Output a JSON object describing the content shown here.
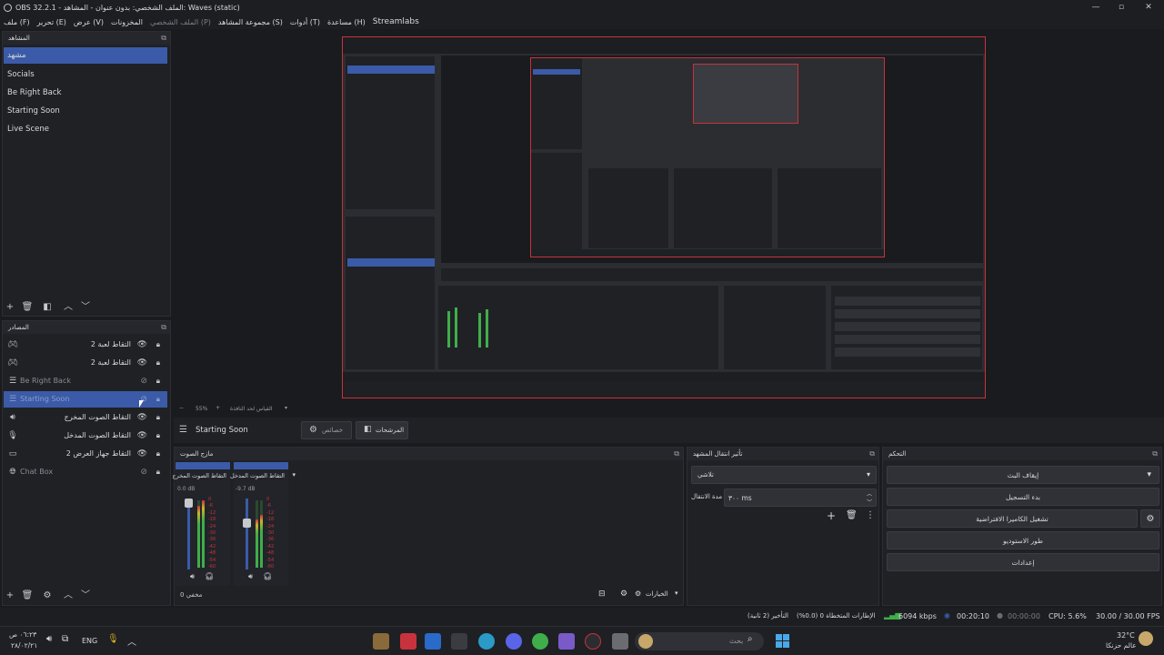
{
  "window": {
    "title": "OBS 32.2.1 - الملف الشخصي: بدون عنوان - المشاهد: Waves (static)",
    "minimize_icon": "—",
    "maximize_icon": "▫",
    "close_icon": "✕"
  },
  "menu": {
    "items": [
      "ملف (F)",
      "تحرير (E)",
      "عرض (V)",
      "المخزونات",
      "الملف الشخصي (P)",
      "مجموعة المشاهد (S)",
      "أدوات (T)",
      "مساعدة (H)",
      "Streamlabs"
    ]
  },
  "scenes": {
    "title": "المشاهد",
    "items": [
      "مشهد",
      "Socials",
      "Be Right Back",
      "Starting Soon",
      "Live Scene"
    ],
    "selected_index": 0
  },
  "sources": {
    "title": "المصادر",
    "items": [
      {
        "name": "التقاط لعبة 2",
        "icon": "gamepad-icon"
      },
      {
        "name": "التقاط لعبة 2",
        "icon": "gamepad-icon"
      },
      {
        "name": "Be Right Back",
        "icon": "list-icon"
      },
      {
        "name": "Starting Soon",
        "icon": "list-icon"
      },
      {
        "name": "التقاط الصوت المخرج",
        "icon": "speaker-icon"
      },
      {
        "name": "التقاط الصوت المدخل",
        "icon": "mic-icon"
      },
      {
        "name": "التقاط جهاز العرض 2",
        "icon": "monitor-icon"
      },
      {
        "name": "Chat Box",
        "icon": "globe-icon"
      }
    ],
    "selected_index": 3
  },
  "preview_bar": {
    "zoom": "55%",
    "fit_label": "القياس لحد النافذة"
  },
  "context_bar": {
    "source_name": "Starting Soon",
    "properties_label": "خصائص",
    "filters_label": "المرشحات"
  },
  "audio_mixer": {
    "title": "مازج الصوت",
    "channels": [
      {
        "name": "التقاط الصوت المخرج",
        "db": "0.0 dB",
        "level": 1.0
      },
      {
        "name": "التقاط الصوت المدخل",
        "db": "-9.7 dB",
        "level": 0.78
      }
    ],
    "scale": [
      "0",
      "-6",
      "-12",
      "-18",
      "-24",
      "-30",
      "-36",
      "-42",
      "-48",
      "-54",
      "-60"
    ],
    "hidden_label": "مخفي 0",
    "options_label": "الخيارات"
  },
  "transitions": {
    "title": "تأثير انتقال المشهد",
    "selected": "تلاشي",
    "duration_label": "مدة الانتقال",
    "duration_value": "٣٠٠ ms"
  },
  "controls": {
    "title": "التحكم",
    "buttons": [
      "إيقاف البث",
      "بدء التسجيل",
      "تشغيل الكاميرا الافتراضية",
      "طور الاستوديو",
      "إعدادات"
    ]
  },
  "status": {
    "frames": "الإطارات المتخطاة 0 (0.0%)",
    "delay": "التأخير (2 ثانية)",
    "bitrate": "6094 kbps",
    "stream_time": "00:20:10",
    "record_time": "00:00:00",
    "cpu": "CPU: 5.6%",
    "fps": "30.00 / 30.00 FPS"
  },
  "taskbar": {
    "time": "٠٦:٢٣ ص",
    "date": "٢٨/٠٢/٢١",
    "lang": "ENG",
    "search_placeholder": "بحث",
    "weather_temp": "32°C",
    "weather_desc": "عالم حزنكا"
  },
  "colors": {
    "accent": "#3b5ba8",
    "canvas_border": "#c8323c",
    "meter_green": "#3fae4a",
    "meter_yellow": "#c9b52a",
    "meter_red": "#c8323c"
  }
}
